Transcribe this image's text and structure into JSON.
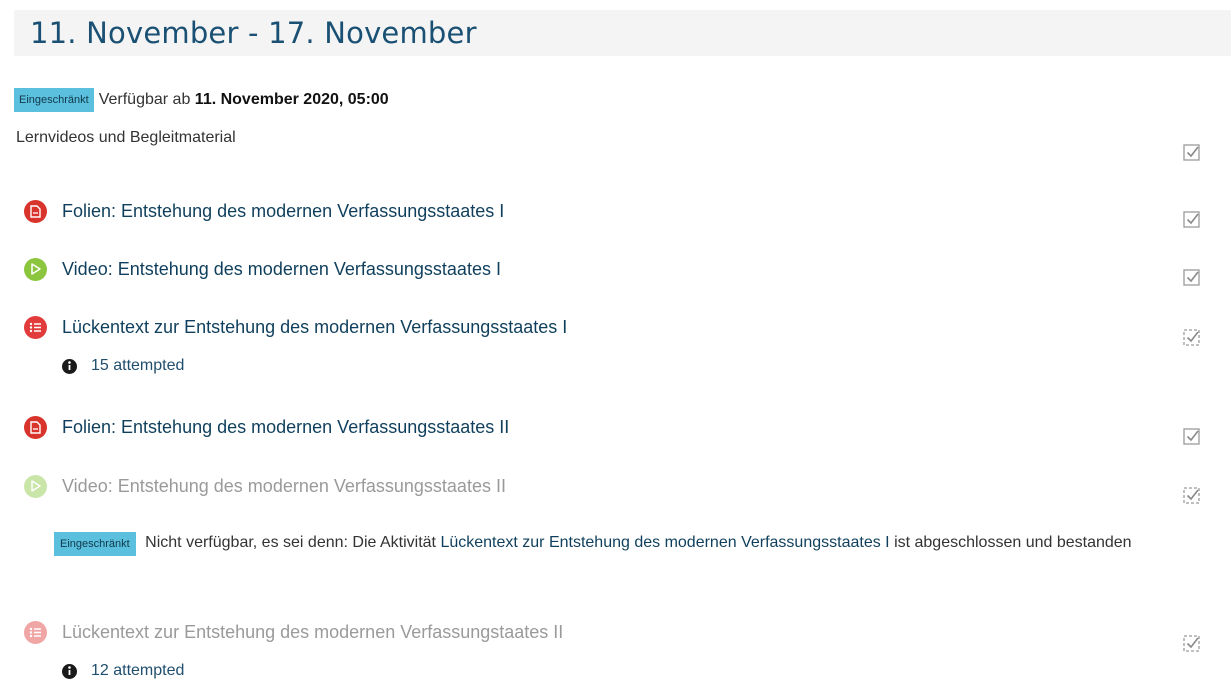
{
  "section": {
    "title": "11. November - 17. November",
    "restriction": {
      "badge": "Eingeschränkt",
      "text": "Verfügbar ab",
      "date": "11. November 2020, 05:00"
    },
    "summary": "Lernvideos und Begleitmaterial"
  },
  "activities": [
    {
      "icon": "pdf-icon",
      "label": "Folien: Entstehung des modernen Verfassungsstaates I",
      "dimmed": false
    },
    {
      "icon": "video-play-icon",
      "label": "Video: Entstehung des modernen Verfassungsstaates I",
      "dimmed": false
    },
    {
      "icon": "quiz-list-icon",
      "label": "Lückentext zur Entstehung des modernen Verfassungsstaates I",
      "dimmed": false,
      "attempted": "15 attempted"
    },
    {
      "icon": "pdf-icon",
      "label": "Folien: Entstehung des modernen Verfassungsstaates II",
      "dimmed": false
    },
    {
      "icon": "video-play-icon",
      "label": "Video: Entstehung des modernen Verfassungsstaates II",
      "dimmed": true
    },
    {
      "icon": "quiz-list-icon",
      "label": "Lückentext zur Entstehung des modernen Verfassungstaates II",
      "dimmed": true,
      "attempted": "12 attempted"
    }
  ],
  "availability": {
    "badge": "Eingeschränkt",
    "text_before": "Nicht verfügbar, es sei denn: Die Aktivität",
    "link": "Lückentext zur Entstehung des modernen Verfassungsstaates I",
    "text_after": "ist abgeschlossen und bestanden"
  },
  "colors": {
    "accent": "#1a5073",
    "link": "#0f3f5c",
    "badge": "#5bc0de",
    "pdf": "#d9342b",
    "video": "#8cc63f",
    "quiz": "#e23b3b"
  }
}
